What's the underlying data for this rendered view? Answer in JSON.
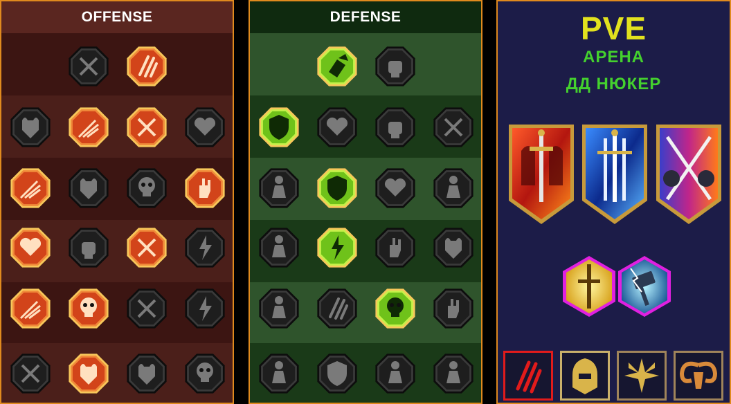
{
  "offense": {
    "title": "OFFENSE",
    "rows": [
      [
        {
          "icon": "crossed-swords-icon",
          "active": false
        },
        {
          "icon": "claw-slash-icon",
          "active": true
        }
      ],
      [
        {
          "icon": "demon-figure-icon",
          "active": false
        },
        {
          "icon": "triple-arrows-icon",
          "active": true
        },
        {
          "icon": "blade-burst-icon",
          "active": true
        },
        {
          "icon": "broken-heart-icon",
          "active": false
        }
      ],
      [
        {
          "icon": "arrow-hit-figure-icon",
          "active": true
        },
        {
          "icon": "fanged-maw-icon",
          "active": false
        },
        {
          "icon": "skull-cloak-icon",
          "active": false
        },
        {
          "icon": "grabbing-hand-icon",
          "active": true
        }
      ],
      [
        {
          "icon": "bleeding-heart-icon",
          "active": true
        },
        {
          "icon": "fist-hammer-icon",
          "active": false
        },
        {
          "icon": "axe-strike-icon",
          "active": true
        },
        {
          "icon": "lightning-chain-icon",
          "active": false
        }
      ],
      [
        {
          "icon": "arrow-volley-icon",
          "active": true
        },
        {
          "icon": "flaming-skulls-icon",
          "active": true
        },
        {
          "icon": "sword-circle-icon",
          "active": false
        },
        {
          "icon": "shocked-figure-icon",
          "active": false
        }
      ],
      [
        {
          "icon": "sparkle-slash-icon",
          "active": false
        },
        {
          "icon": "burning-knight-icon",
          "active": true
        },
        {
          "icon": "horned-beast-icon",
          "active": false
        },
        {
          "icon": "spiked-skull-icon",
          "active": false
        }
      ]
    ]
  },
  "defense": {
    "title": "DEFENSE",
    "rows": [
      [
        {
          "icon": "armor-scales-icon",
          "active": true
        },
        {
          "icon": "raised-fist-icon",
          "active": false
        }
      ],
      [
        {
          "icon": "chevron-shield-icon",
          "active": true
        },
        {
          "icon": "armored-heart-icon",
          "active": false
        },
        {
          "icon": "stone-golem-icon",
          "active": false
        },
        {
          "icon": "crossed-blades-icon",
          "active": false
        }
      ],
      [
        {
          "icon": "healer-figure-icon",
          "active": false
        },
        {
          "icon": "knight-shield-icon",
          "active": true
        },
        {
          "icon": "heart-skull-icon",
          "active": false
        },
        {
          "icon": "hooded-head-icon",
          "active": false
        }
      ],
      [
        {
          "icon": "cheering-crowd-icon",
          "active": false
        },
        {
          "icon": "hourglass-sun-icon",
          "active": true
        },
        {
          "icon": "open-palm-icon",
          "active": false
        },
        {
          "icon": "bull-head-icon",
          "active": false
        }
      ],
      [
        {
          "icon": "dashing-figure-icon",
          "active": false
        },
        {
          "icon": "talon-claws-icon",
          "active": false
        },
        {
          "icon": "radiant-skull-icon",
          "active": true
        },
        {
          "icon": "swirling-hand-icon",
          "active": false
        }
      ],
      [
        {
          "icon": "crowned-warrior-icon",
          "active": false
        },
        {
          "icon": "winged-shield-icon",
          "active": false
        },
        {
          "icon": "helmed-warrior-icon",
          "active": false
        },
        {
          "icon": "strongman-icon",
          "active": false
        }
      ]
    ]
  },
  "info": {
    "title": "PVE",
    "line1": "АРЕНА",
    "line2": "ДД НЮКЕР",
    "banners": [
      {
        "icon": "red-knight-sword-banner-icon"
      },
      {
        "icon": "blue-triple-swords-banner-icon"
      },
      {
        "icon": "crossed-swords-duel-banner-icon"
      }
    ],
    "gems": [
      {
        "icon": "golden-sword-gem-icon"
      },
      {
        "icon": "lightning-hammer-gem-icon"
      }
    ],
    "factions": [
      {
        "icon": "red-claw-marks-icon",
        "selected": true
      },
      {
        "icon": "golden-knight-portrait-icon",
        "selected": false
      },
      {
        "icon": "star-burst-emblem-icon",
        "selected": false
      },
      {
        "icon": "ram-horns-emblem-icon",
        "selected": false
      }
    ]
  },
  "colors": {
    "offense_active": "#e0521a",
    "defense_active": "#7ed321",
    "inactive": "#1f1f1f",
    "accent_title": "#e2e21e",
    "accent_sub": "#44d12e",
    "panel_border": "#e08a1e",
    "gem_border": "#e020e0",
    "faction_selected": "#e21b1b"
  }
}
